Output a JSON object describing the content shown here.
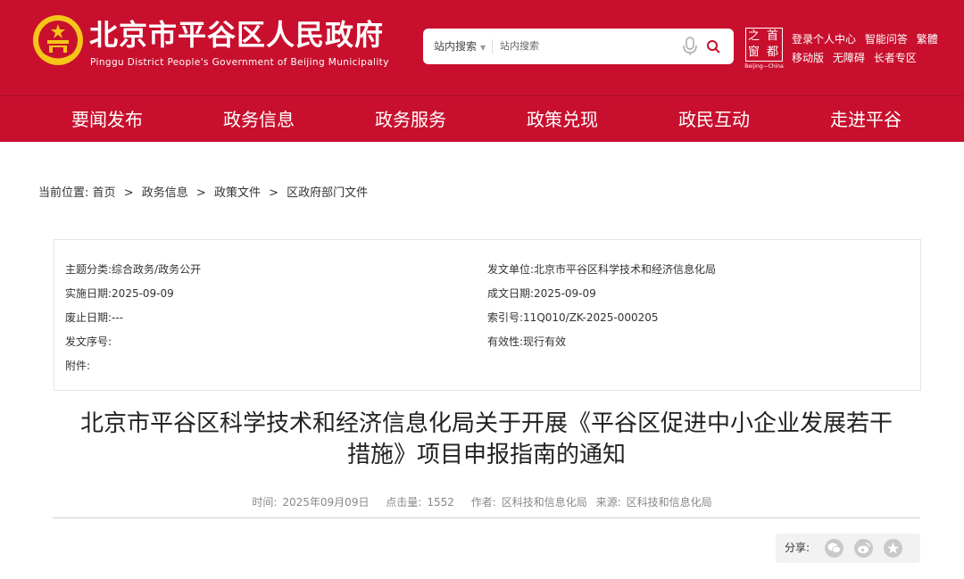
{
  "header": {
    "title": "北京市平谷区人民政府",
    "subtitle": "Pinggu District People's Government of Beijing Municipality",
    "search_scope": "站内搜索",
    "search_placeholder": "站内搜索",
    "capital_logo_chars": [
      "之",
      "首",
      "窗",
      "都"
    ],
    "capital_logo_sub": "Beijing—China",
    "links_row1": [
      "登录个人中心",
      "智能问答",
      "繁體"
    ],
    "links_row2": [
      "移动版",
      "无障碍",
      "长者专区"
    ]
  },
  "nav": {
    "items": [
      "要闻发布",
      "政务信息",
      "政务服务",
      "政策兑现",
      "政民互动",
      "走进平谷"
    ]
  },
  "breadcrumb": {
    "prefix": "当前位置:",
    "items": [
      "首页",
      "政务信息",
      "政策文件",
      "区政府部门文件"
    ],
    "separator": ">"
  },
  "meta": {
    "left": [
      {
        "label": "主题分类:",
        "value": "综合政务/政务公开"
      },
      {
        "label": "实施日期:",
        "value": "2025-09-09"
      },
      {
        "label": "废止日期:",
        "value": "---"
      },
      {
        "label": "发文序号:",
        "value": ""
      },
      {
        "label": "附件:",
        "value": ""
      }
    ],
    "right": [
      {
        "label": "发文单位:",
        "value": "北京市平谷区科学技术和经济信息化局"
      },
      {
        "label": "成文日期:",
        "value": "2025-09-09"
      },
      {
        "label": "索引号:",
        "value": "11Q010/ZK-2025-000205"
      },
      {
        "label": "有效性:",
        "value": "现行有效"
      }
    ]
  },
  "article": {
    "title_line1": "北京市平谷区科学技术和经济信息化局关于开展《平谷区促进中小企业发展若干",
    "title_line2": "措施》项目申报指南的通知",
    "time_label": "时间:",
    "time_value": "2025年09月09日",
    "clicks_label": "点击量:",
    "clicks_value": "1552",
    "author_label": "作者:",
    "author_value": "区科技和信息化局",
    "source_label": "来源:",
    "source_value": "区科技和信息化局"
  },
  "share": {
    "label": "分享:",
    "icons": [
      "wechat-icon",
      "weibo-icon",
      "favorite-icon"
    ]
  },
  "colors": {
    "brand_red": "#c8102e",
    "emblem_gold": "#f5c518"
  }
}
